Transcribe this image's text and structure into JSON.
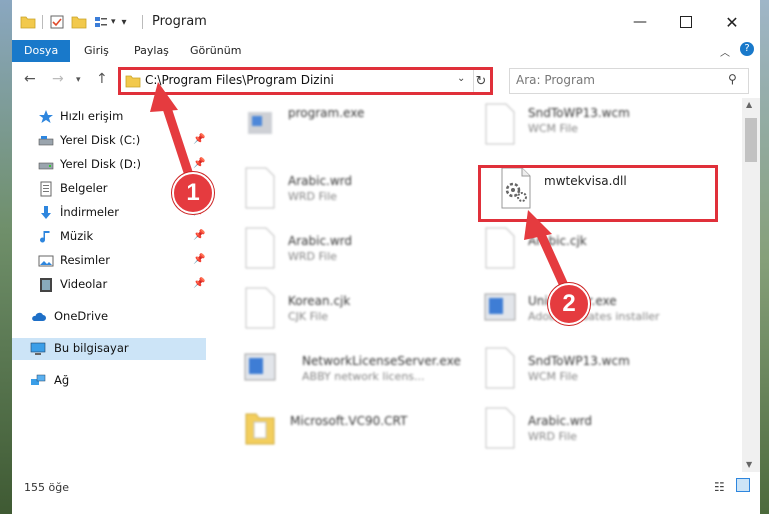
{
  "window": {
    "title": "Program"
  },
  "ribbon": {
    "tabs": [
      "Dosya",
      "Giriş",
      "Paylaş",
      "Görünüm"
    ]
  },
  "address": {
    "path": "C:\\Program Files\\Program Dizini",
    "search_placeholder": "Ara: Program"
  },
  "nav": {
    "items": [
      {
        "label": "Hızlı erişim",
        "icon": "star-icon"
      },
      {
        "label": "Yerel Disk (C:)",
        "icon": "drive-icon"
      },
      {
        "label": "Yerel Disk (D:)",
        "icon": "drive-icon"
      },
      {
        "label": "Belgeler",
        "icon": "documents-icon"
      },
      {
        "label": "İndirmeler",
        "icon": "download-icon"
      },
      {
        "label": "Müzik",
        "icon": "music-icon"
      },
      {
        "label": "Resimler",
        "icon": "pictures-icon"
      },
      {
        "label": "Videolar",
        "icon": "video-icon"
      },
      {
        "label": "OneDrive",
        "icon": "cloud-icon"
      },
      {
        "label": "Bu bilgisayar",
        "icon": "computer-icon"
      },
      {
        "label": "Ağ",
        "icon": "network-icon"
      }
    ]
  },
  "files": [
    {
      "name": "program.exe",
      "type": ""
    },
    {
      "name": "SndToWP13.wcm",
      "type": "WCM File"
    },
    {
      "name": "Arabic.wrd",
      "type": "WRD File"
    },
    {
      "name": "mwtekvisa.dll",
      "type": ""
    },
    {
      "name": "Arabic.wrd",
      "type": "WRD File"
    },
    {
      "name": "Arabic.cjk",
      "type": ""
    },
    {
      "name": "Korean.cjk",
      "type": "CJK File"
    },
    {
      "name": "Uninstaller.exe",
      "type": "Adobe Updates installer"
    },
    {
      "name": "NetworkLicenseServer.exe",
      "type": "ABBY network licens..."
    },
    {
      "name": "SndToWP13.wcm",
      "type": "WCM File"
    },
    {
      "name": "Microsoft.VC90.CRT",
      "type": ""
    },
    {
      "name": "Arabic.wrd",
      "type": "WRD File"
    }
  ],
  "status": {
    "count": "155 öğe"
  },
  "annotations": {
    "step1": "1",
    "step2": "2"
  },
  "colors": {
    "accent": "#1979ca",
    "annotation": "#e53b3f"
  }
}
